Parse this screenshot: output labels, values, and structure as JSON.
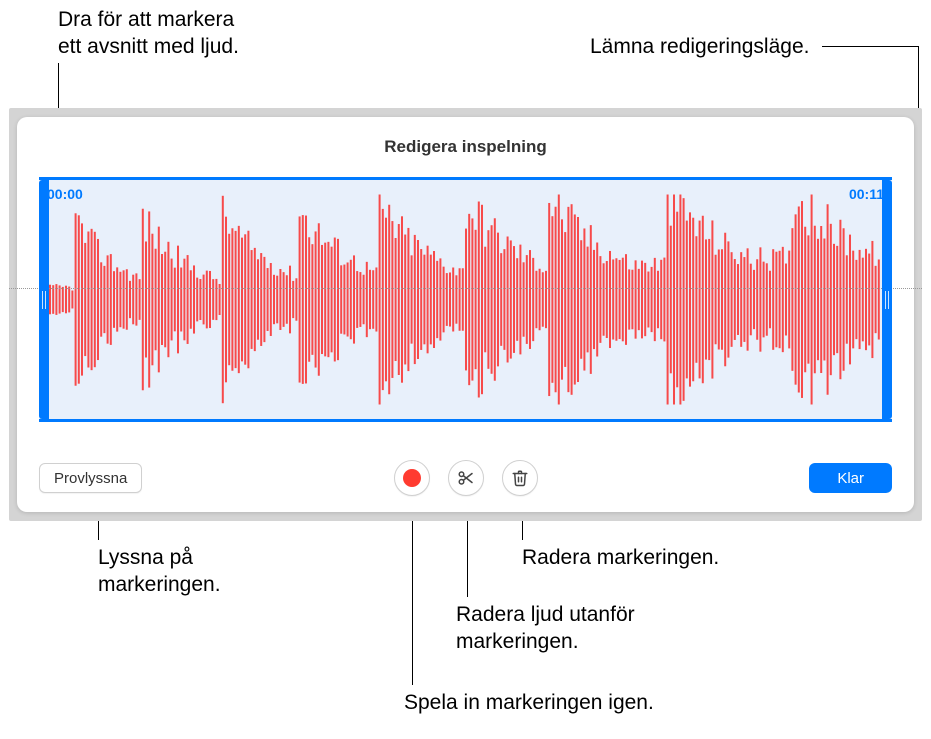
{
  "callouts": {
    "drag_select": "Dra för att markera\nett avsnitt med ljud.",
    "exit_edit": "Lämna redigeringsläge.",
    "listen": "Lyssna på\nmarkeringen.",
    "delete_selection": "Radera markeringen.",
    "delete_outside": "Radera ljud utanför\nmarkeringen.",
    "re_record": "Spela in markeringen igen."
  },
  "editor": {
    "title": "Redigera inspelning",
    "time_start": "00:00",
    "time_end": "00:11"
  },
  "buttons": {
    "preview": "Provlyssna",
    "done": "Klar"
  },
  "icons": {
    "record": "record-icon",
    "trim": "scissors-icon",
    "delete": "trash-icon"
  },
  "colors": {
    "accent": "#007aff",
    "waveform": "#f74a4a",
    "record": "#ff3b30"
  }
}
